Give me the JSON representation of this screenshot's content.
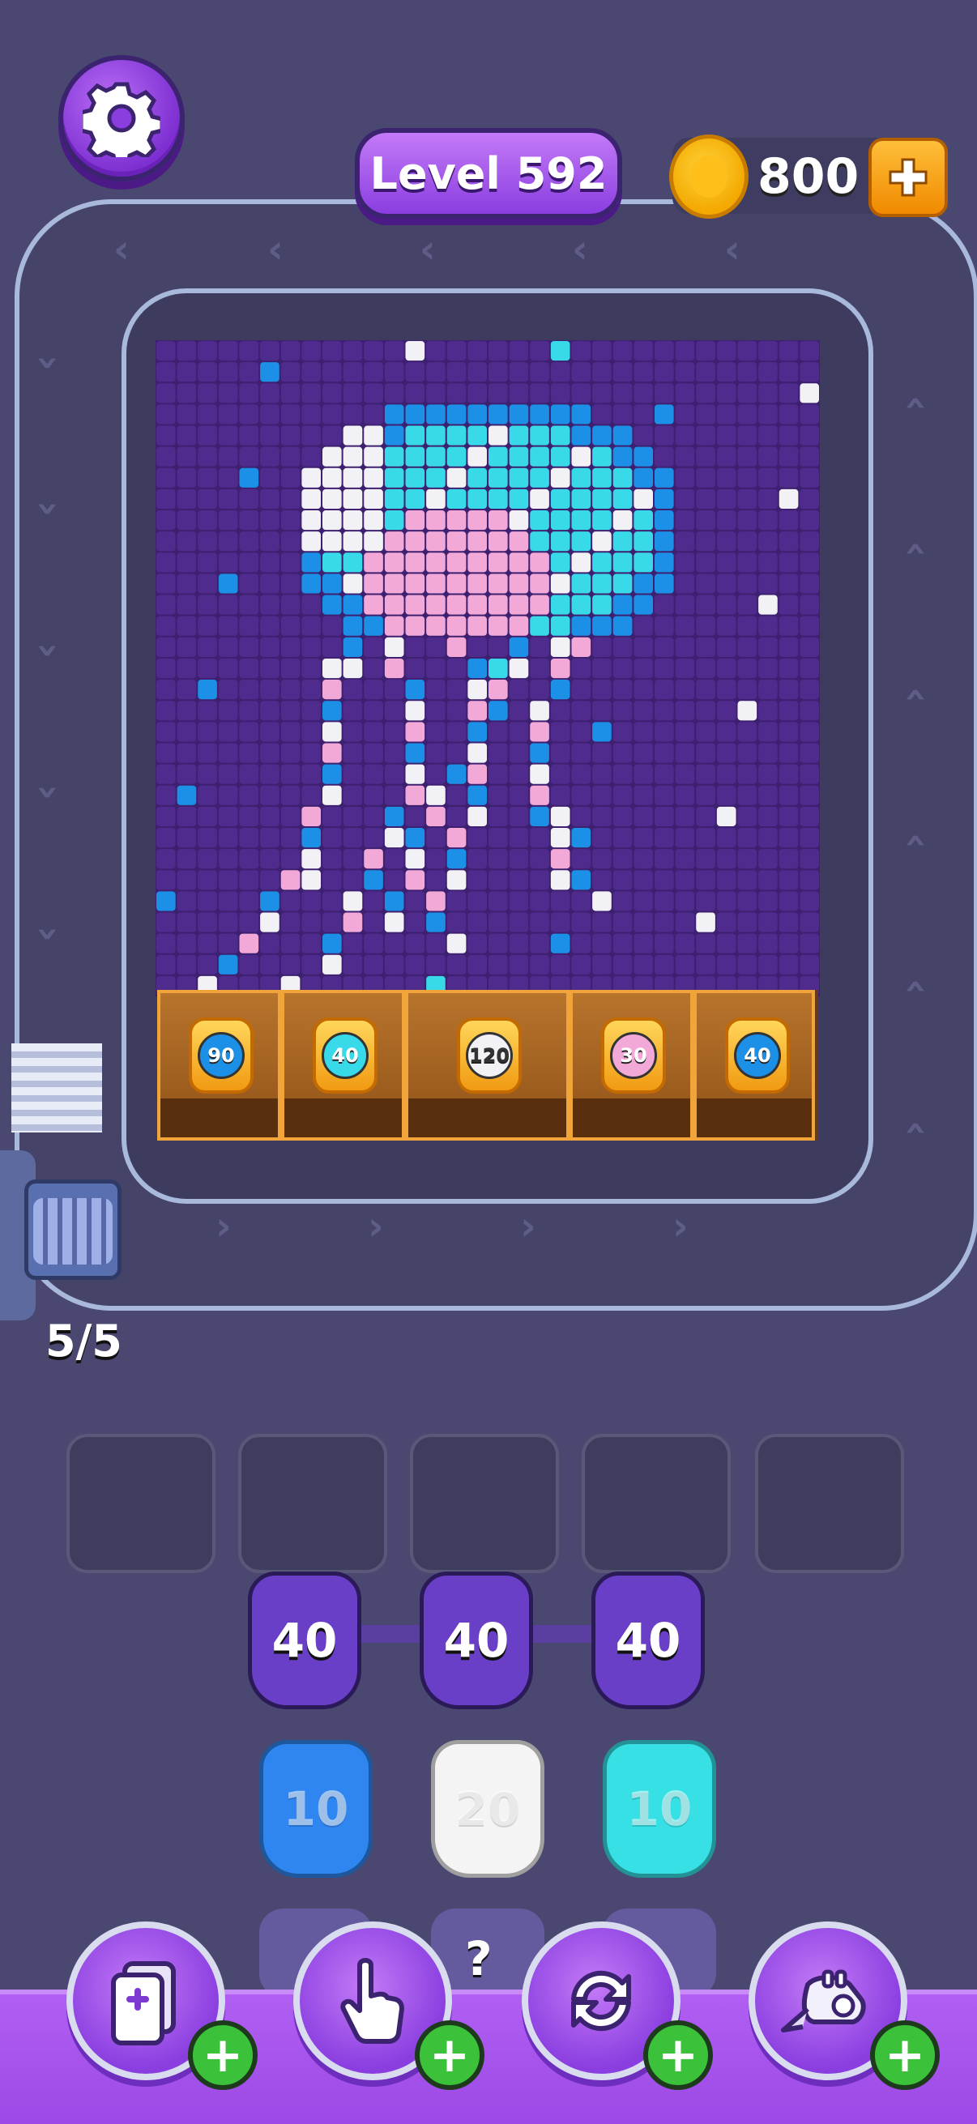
{
  "header": {
    "level_label": "Level 592",
    "coins": "800",
    "settings_icon": "gear-icon",
    "add_coins_icon": "plus-icon"
  },
  "board": {
    "picture": "pixel jellyfish",
    "palette": {
      "bg": "#4f2b8e",
      "white": "#f2f2f6",
      "cyan": "#38d9e8",
      "blue": "#1c8fe6",
      "pink": "#f2a9d8"
    }
  },
  "containers": [
    {
      "value": "90",
      "color": "#1c8fe6"
    },
    {
      "value": "40",
      "color": "#38d9e8"
    },
    {
      "value": "120",
      "color": "#f2f2f6"
    },
    {
      "value": "30",
      "color": "#f2a9d8"
    },
    {
      "value": "40",
      "color": "#1c8fe6"
    }
  ],
  "stack": {
    "count_label": "5/5"
  },
  "slots": [
    "",
    "",
    "",
    "",
    ""
  ],
  "jugs": {
    "locked_row": [
      {
        "value": "40",
        "color": "#6a3fc8"
      },
      {
        "value": "40",
        "color": "#6a3fc8"
      },
      {
        "value": "40",
        "color": "#6a3fc8"
      }
    ],
    "front_row": [
      {
        "value": "10",
        "color": "#2f86f0"
      },
      {
        "value": "20",
        "color": "#f4f4f4"
      },
      {
        "value": "10",
        "color": "#37e0e4"
      }
    ],
    "hidden_label": "?"
  },
  "boosters": [
    {
      "name": "add-slot-booster",
      "icon": "add-card-icon"
    },
    {
      "name": "hand-booster",
      "icon": "pointing-hand-icon"
    },
    {
      "name": "shuffle-booster",
      "icon": "refresh-icon"
    },
    {
      "name": "vacuum-booster",
      "icon": "vacuum-icon"
    }
  ]
}
